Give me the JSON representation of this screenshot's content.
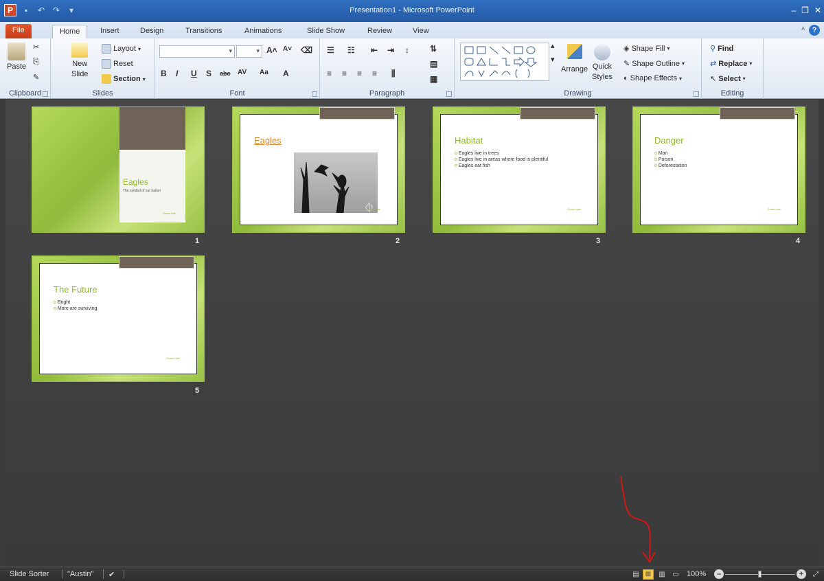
{
  "window": {
    "title": "Presentation1 - Microsoft PowerPoint",
    "logo_letter": "P"
  },
  "tabs": [
    "File",
    "Home",
    "Insert",
    "Design",
    "Transitions",
    "Animations",
    "Slide Show",
    "Review",
    "View"
  ],
  "ribbon": {
    "clipboard": {
      "label": "Clipboard",
      "paste": "Paste"
    },
    "slides": {
      "label": "Slides",
      "new_slide": "New",
      "new_slide_2": "Slide",
      "layout": "Layout",
      "reset": "Reset",
      "section": "Section"
    },
    "font": {
      "label": "Font"
    },
    "paragraph": {
      "label": "Paragraph"
    },
    "drawing": {
      "label": "Drawing",
      "arrange": "Arrange",
      "quick_styles": "Quick",
      "quick_styles_2": "Styles",
      "shape_fill": "Shape Fill",
      "shape_outline": "Shape Outline",
      "shape_effects": "Shape Effects"
    },
    "editing": {
      "label": "Editing",
      "find": "Find",
      "replace": "Replace",
      "select": "Select"
    }
  },
  "slides": [
    {
      "number": "1",
      "title": "Eagles",
      "subtitle": "The symbol of our nation",
      "footer": "Guam baie"
    },
    {
      "number": "2",
      "title": "Eagles",
      "footer": "Guam baie"
    },
    {
      "number": "3",
      "title": "Habitat",
      "bullets": [
        "Eagles live in trees",
        "Eagles live in areas where food is plentiful",
        "Eagles eat fish"
      ],
      "footer": "Guam baie"
    },
    {
      "number": "4",
      "title": "Danger",
      "bullets": [
        "Man",
        "Poison",
        "Deforestation"
      ],
      "footer": "Guam baie"
    },
    {
      "number": "5",
      "title": "The Future",
      "bullets": [
        "Bright",
        "More are surviving"
      ],
      "footer": "Guam baie"
    }
  ],
  "status": {
    "view_name": "Slide Sorter",
    "theme": "\"Austin\"",
    "zoom": "100%"
  },
  "colors": {
    "accent_green": "#8dbb2a",
    "title_bar": "#2f6fbf",
    "file_tab": "#d24726",
    "annotation_arrow": "#d01818"
  }
}
